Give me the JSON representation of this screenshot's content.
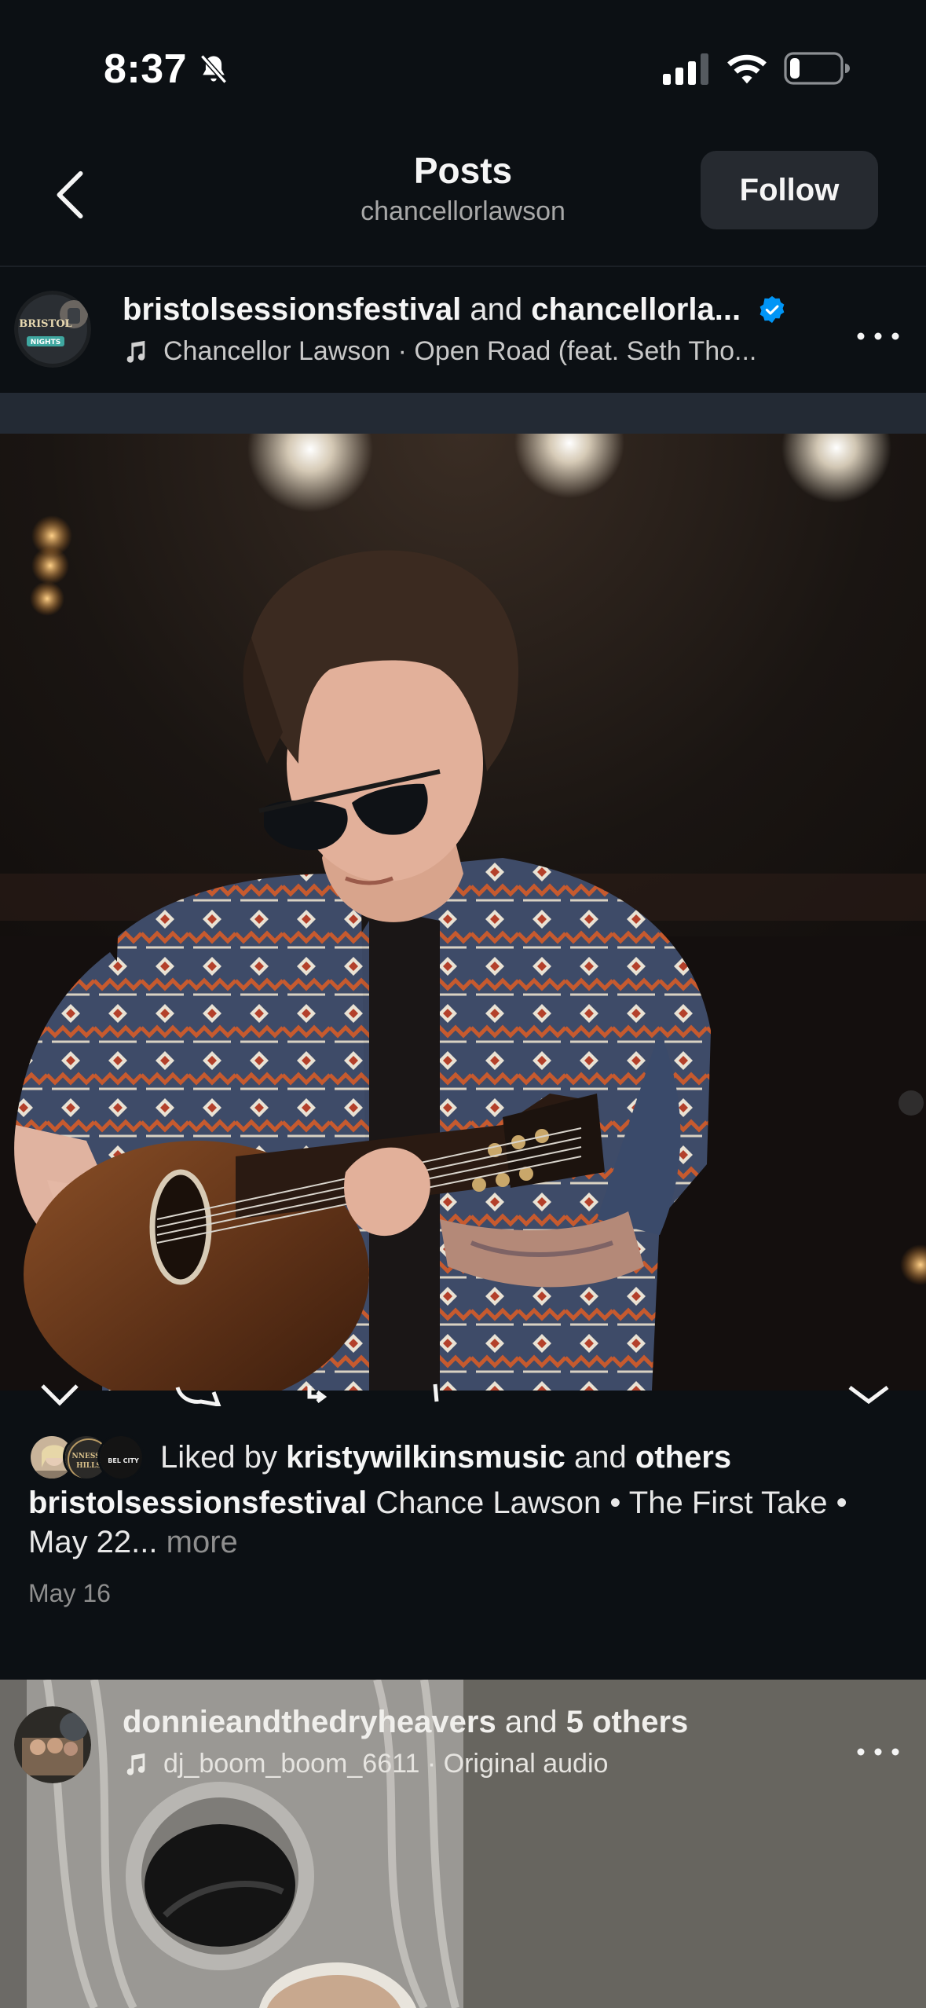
{
  "status_bar": {
    "time": "8:37",
    "icons": [
      "bell-slash-icon",
      "cellular-signal-icon",
      "wifi-icon",
      "battery-icon"
    ]
  },
  "header": {
    "title": "Posts",
    "subtitle": "chancellorlawson",
    "follow_label": "Follow"
  },
  "post1": {
    "account_primary": "bristolsessionsfestival",
    "connector": "and",
    "account_secondary": "chancellorla...",
    "verified": true,
    "audio": "Chancellor Lawson · Open Road (feat. Seth Tho...",
    "liked_prefix": "Liked by",
    "liked_user": "kristywilkinsmusic",
    "liked_connector": "and",
    "liked_others": "others",
    "caption_user": "bristolsessionsfestival",
    "caption_text": "Chance Lawson • The First Take • May 22...",
    "caption_more": "more",
    "date": "May 16",
    "avatar_texts": [
      "BRISTOL",
      "NIGHTS",
      "NNESSE",
      "HILLS",
      "BEL CITY"
    ]
  },
  "post2": {
    "account_primary": "donnieandthedryheavers",
    "connector": "and",
    "others": "5 others",
    "audio": "dj_boom_boom_6611 · Original audio"
  },
  "colors": {
    "background": "#0c1014",
    "button_bg": "#262a30",
    "verified_blue": "#0095f6",
    "secondary_text": "#8e8e8e"
  }
}
